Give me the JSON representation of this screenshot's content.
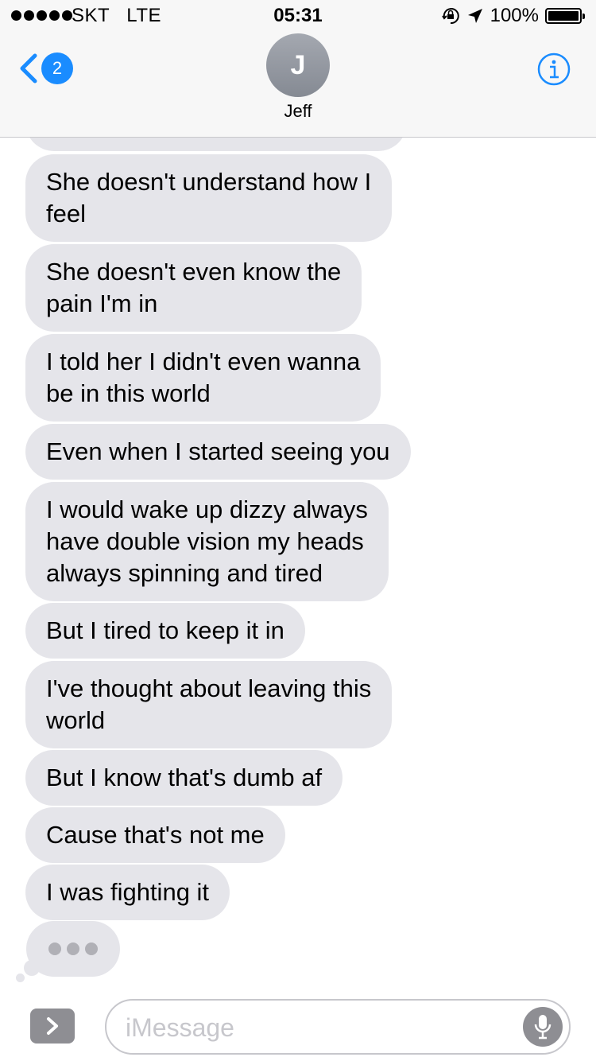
{
  "status_bar": {
    "carrier": "SKT   LTE",
    "time": "05:31",
    "battery": "100%",
    "battery_level": 1.0,
    "icons": [
      "signal-dots-icon",
      "orientation-lock-icon",
      "location-arrow-icon",
      "battery-icon"
    ]
  },
  "header": {
    "unread_count": "2",
    "avatar_initial": "J",
    "contact_name": "Jeff",
    "icons": [
      "chevron-left-icon",
      "info-icon"
    ]
  },
  "messages": [
    {
      "text": "She doesn't understand how I\nfeel"
    },
    {
      "text": "She doesn't even know the\npain I'm in"
    },
    {
      "text": "I told her I didn't even wanna\nbe in this world"
    },
    {
      "text": "Even when I started seeing you"
    },
    {
      "text": "I would wake up dizzy always\nhave double vision my heads\nalways spinning and tired"
    },
    {
      "text": "But I tired to keep it in"
    },
    {
      "text": "I've thought about leaving this\nworld"
    },
    {
      "text": "But I know that's dumb af"
    },
    {
      "text": "Cause that's not me"
    },
    {
      "text": "I was fighting it"
    }
  ],
  "input_bar": {
    "placeholder": "iMessage",
    "value": "",
    "icons": [
      "chevron-right-icon",
      "microphone-icon"
    ]
  },
  "colors": {
    "accent": "#1a8cff",
    "incoming_bubble": "#e5e5ea",
    "header_bg": "#f7f7f7",
    "muted_gray": "#8e8e93"
  }
}
